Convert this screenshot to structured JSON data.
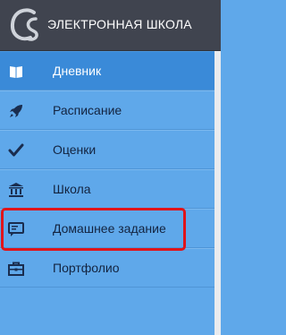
{
  "header": {
    "title": "ЭЛЕКТРОННАЯ ШКОЛА",
    "logo_icon": "school-logo-icon"
  },
  "nav": {
    "items": [
      {
        "label": "Дневник",
        "icon": "book-icon",
        "active": true
      },
      {
        "label": "Расписание",
        "icon": "rocket-icon",
        "active": false
      },
      {
        "label": "Оценки",
        "icon": "checkmark-icon",
        "active": false
      },
      {
        "label": "Школа",
        "icon": "institution-icon",
        "active": false
      },
      {
        "label": "Домашнее задание",
        "icon": "homework-icon",
        "active": false
      },
      {
        "label": "Портфолио",
        "icon": "briefcase-icon",
        "active": false
      }
    ]
  },
  "colors": {
    "header_bg": "#40444f",
    "nav_bg": "#5fa8ea",
    "active_bg": "#3a8ad8",
    "highlight": "#e0141a"
  }
}
